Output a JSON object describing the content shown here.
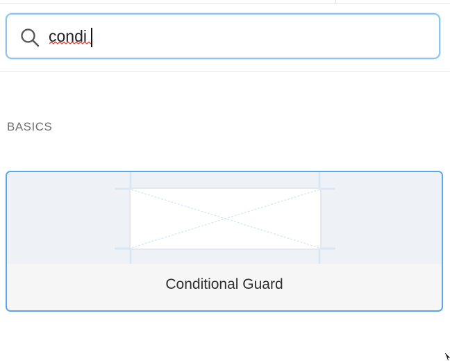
{
  "search": {
    "value": "condi",
    "placeholder": "",
    "icon": "search-icon",
    "focus_color": "#8ec5f1"
  },
  "section": {
    "title": "BASICS"
  },
  "results": [
    {
      "label": "Conditional Guard",
      "thumbnail_icon": "placeholder-box-icon",
      "selected": true,
      "border_color": "#5aa6e6"
    }
  ]
}
